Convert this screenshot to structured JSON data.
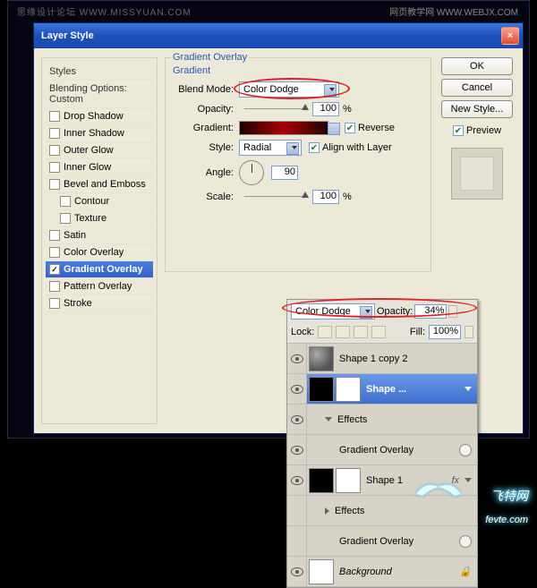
{
  "watermarks": {
    "tl": "思缘设计论坛 WWW.MISSYUAN.COM",
    "tr": "网页教学网 WWW.WEBJX.COM",
    "logo_cn": "飞特网",
    "logo_en": "fevte.com"
  },
  "dialog": {
    "title": "Layer Style",
    "styles_header": "Styles",
    "blending_header": "Blending Options: Custom",
    "styles": [
      {
        "label": "Drop Shadow",
        "checked": false
      },
      {
        "label": "Inner Shadow",
        "checked": false
      },
      {
        "label": "Outer Glow",
        "checked": false
      },
      {
        "label": "Inner Glow",
        "checked": false
      },
      {
        "label": "Bevel and Emboss",
        "checked": false
      },
      {
        "label": "Contour",
        "checked": false,
        "indent": true
      },
      {
        "label": "Texture",
        "checked": false,
        "indent": true
      },
      {
        "label": "Satin",
        "checked": false
      },
      {
        "label": "Color Overlay",
        "checked": false
      },
      {
        "label": "Gradient Overlay",
        "checked": true,
        "selected": true
      },
      {
        "label": "Pattern Overlay",
        "checked": false
      },
      {
        "label": "Stroke",
        "checked": false
      }
    ],
    "section_title": "Gradient Overlay",
    "gradient_label": "Gradient",
    "blend_mode_lbl": "Blend Mode:",
    "blend_mode_val": "Color Dodge",
    "opacity_lbl": "Opacity:",
    "opacity_val": "100",
    "pct": "%",
    "gradient_lbl": "Gradient:",
    "reverse_lbl": "Reverse",
    "reverse_chk": true,
    "style_lbl": "Style:",
    "style_val": "Radial",
    "align_lbl": "Align with Layer",
    "align_chk": true,
    "angle_lbl": "Angle:",
    "angle_val": "90",
    "deg": "",
    "scale_lbl": "Scale:",
    "scale_val": "100",
    "buttons": {
      "ok": "OK",
      "cancel": "Cancel",
      "newstyle": "New Style..."
    },
    "preview_lbl": "Preview",
    "preview_chk": true
  },
  "layers_panel": {
    "mode_val": "Color Dodge",
    "opacity_lbl": "Opacity:",
    "opacity_val": "34%",
    "lock_lbl": "Lock:",
    "fill_lbl": "Fill:",
    "fill_val": "100%",
    "layers": [
      {
        "name": "Shape 1 copy 2",
        "thumb": "cloud"
      },
      {
        "name": "Shape ...",
        "thumb": "black",
        "mask": true,
        "selected": true,
        "fx": false
      },
      {
        "name": "Effects",
        "sub": true,
        "toggle": "down"
      },
      {
        "name": "Gradient Overlay",
        "sub": true,
        "eye": true,
        "fxcircle": true
      },
      {
        "name": "Shape 1",
        "thumb": "black",
        "mask": true,
        "fx": true
      },
      {
        "name": "Effects",
        "sub": true,
        "toggle": "right"
      },
      {
        "name": "Gradient Overlay",
        "sub": true,
        "eye": false,
        "fxcircle": true
      },
      {
        "name": "Background",
        "thumb": "white",
        "locked": true
      }
    ]
  }
}
